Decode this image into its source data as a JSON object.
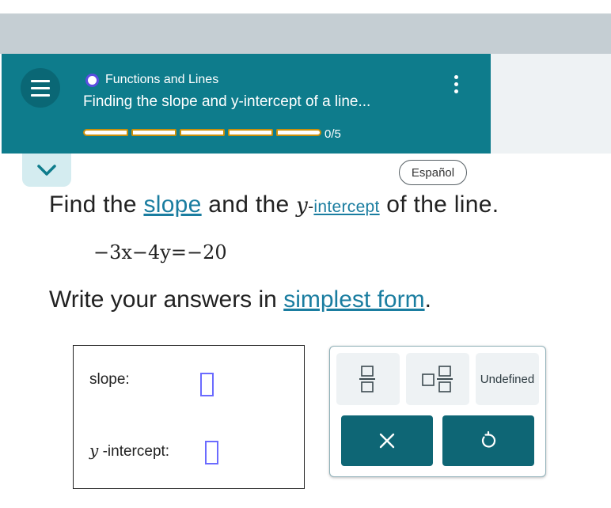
{
  "header": {
    "topic": "Functions and Lines",
    "lesson_title": "Finding the slope and y-intercept of a line...",
    "progress_text": "0/5",
    "progress": {
      "completed": 0,
      "total": 5
    }
  },
  "language_button": "Español",
  "question": {
    "part1": "Find the ",
    "slope_link": "slope",
    "part2": " and the ",
    "y_var": "y",
    "dash": "-",
    "intercept_link": "intercept",
    "part3": " of the line."
  },
  "equation": "−3x−4y=−20",
  "instruction": {
    "part1": "Write your answers in ",
    "link": "simplest form",
    "part2": "."
  },
  "answers": {
    "slope_label": "slope:",
    "y_var": "y",
    "intercept_label": " -intercept:"
  },
  "keypad": {
    "undefined_label": "Undefined",
    "keys": [
      "fraction-icon",
      "mixed-number-icon",
      "undefined",
      "clear-icon",
      "undo-icon"
    ]
  },
  "colors": {
    "header": "#0e7c8c",
    "link": "#1a7da0",
    "progress_border": "#c98f0b",
    "action_button": "#0e6675",
    "input_border": "#6b6bff"
  }
}
